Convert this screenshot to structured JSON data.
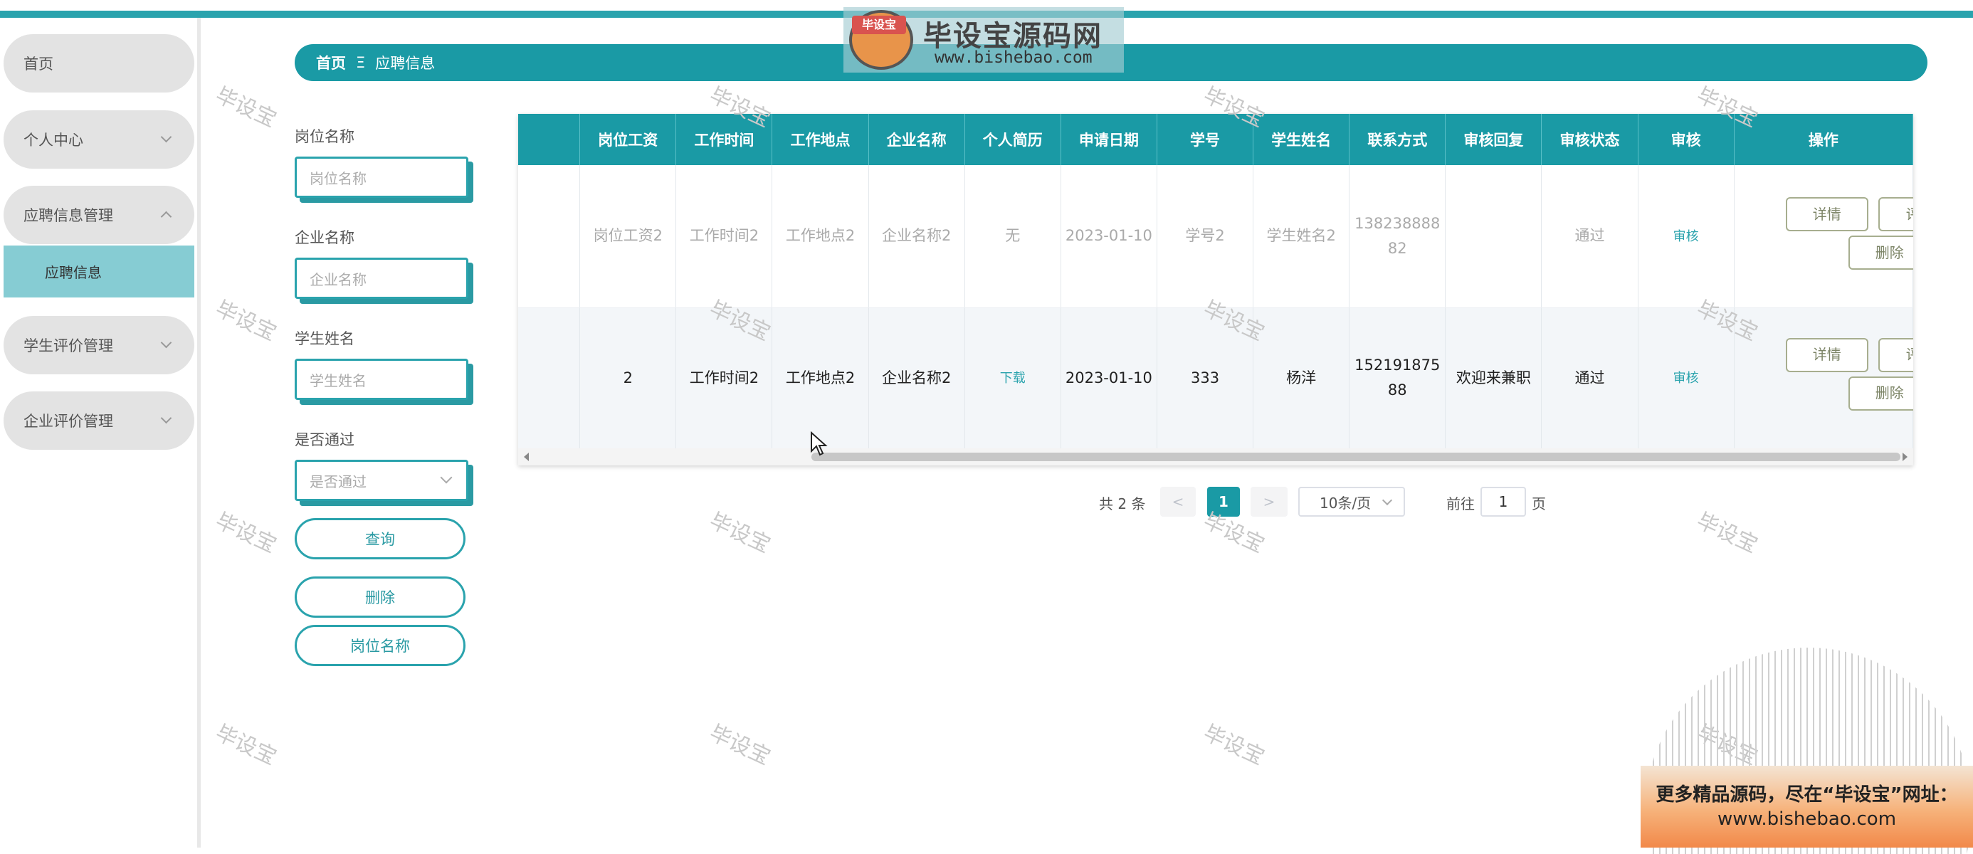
{
  "logo": {
    "badge": "毕设宝",
    "title": "毕设宝源码网",
    "url": "www.bishebao.com"
  },
  "sidebar": {
    "items": [
      {
        "label": "首页"
      },
      {
        "label": "个人中心"
      },
      {
        "label": "应聘信息管理"
      },
      {
        "label": "学生评价管理"
      },
      {
        "label": "企业评价管理"
      }
    ],
    "sub_item": "应聘信息"
  },
  "breadcrumb": {
    "home": "首页",
    "separator": "Ξ",
    "current": "应聘信息"
  },
  "filters": {
    "position_label": "岗位名称",
    "position_placeholder": "岗位名称",
    "company_label": "企业名称",
    "company_placeholder": "企业名称",
    "student_label": "学生姓名",
    "student_placeholder": "学生姓名",
    "passed_label": "是否通过",
    "passed_placeholder": "是否通过",
    "query_button": "查询",
    "delete_button": "删除",
    "position_button": "岗位名称"
  },
  "table": {
    "headers": [
      "岗位工资",
      "工作时间",
      "工作地点",
      "企业名称",
      "个人简历",
      "申请日期",
      "学号",
      "学生姓名",
      "联系方式",
      "审核回复",
      "审核状态",
      "审核",
      "操作"
    ],
    "rows": [
      {
        "salary": "岗位工资2",
        "work_time": "工作时间2",
        "location": "工作地点2",
        "company": "企业名称2",
        "resume": "无",
        "date": "2023-01-10",
        "student_id": "学号2",
        "student_name": "学生姓名2",
        "contact": "13823888882",
        "reply": "",
        "status": "通过",
        "review": "审核"
      },
      {
        "salary": "2",
        "work_time": "工作时间2",
        "location": "工作地点2",
        "company": "企业名称2",
        "resume": "下载",
        "date": "2023-01-10",
        "student_id": "333",
        "student_name": "杨洋",
        "contact": "15219187588",
        "reply": "欢迎来兼职",
        "status": "通过",
        "review": "审核"
      }
    ],
    "actions": {
      "detail": "详情",
      "evaluate": "评价学生",
      "delete": "删除"
    }
  },
  "pagination": {
    "total": "共 2 条",
    "prev": "<",
    "current_page": "1",
    "next": ">",
    "page_size": "10条/页",
    "goto_prefix": "前往",
    "goto_value": "1",
    "goto_suffix": "页"
  },
  "watermark": "毕设宝",
  "promo": {
    "line1": "更多精品源码，尽在“毕设宝”网址：",
    "line2": "www.bishebao.com"
  },
  "colors": {
    "accent": "#1a9aa5",
    "sidebar_item": "#e3e3e3",
    "sidebar_active": "#86ccd3"
  }
}
